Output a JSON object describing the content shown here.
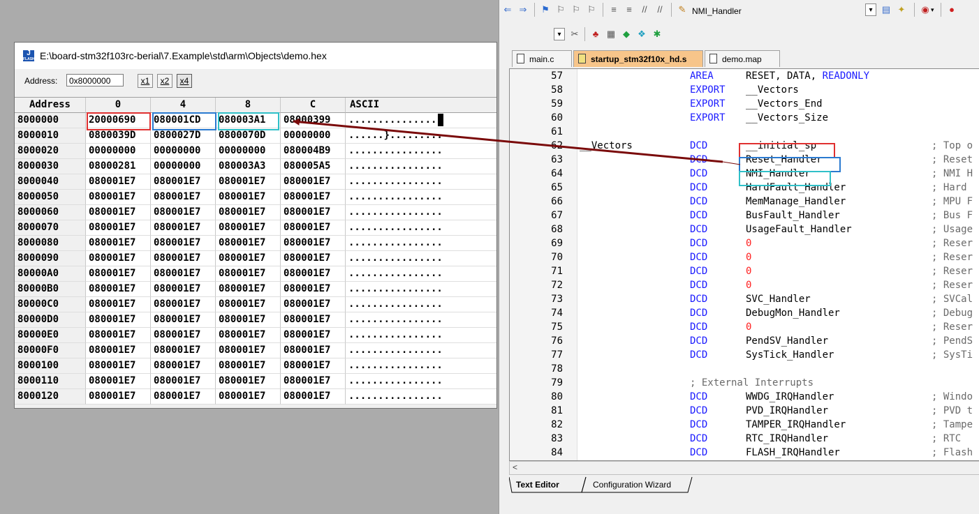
{
  "hex_window": {
    "title": "E:\\board-stm32f103rc-berial\\7.Example\\std\\arm\\Objects\\demo.hex",
    "icon_text": "J",
    "icon_subtext": "FLASH",
    "address_label": "Address:",
    "address_value": "0x8000000",
    "zoom_buttons": [
      "x1",
      "x2",
      "x4"
    ],
    "columns": [
      "Address",
      "0",
      "4",
      "8",
      "C",
      "ASCII"
    ],
    "rows": [
      [
        "8000000",
        "20000690",
        "080001CD",
        "080003A1",
        "08000399",
        "..............."
      ],
      [
        "8000010",
        "0800039D",
        "0800027D",
        "0800070D",
        "00000000",
        "......}........."
      ],
      [
        "8000020",
        "00000000",
        "00000000",
        "00000000",
        "080004B9",
        "................"
      ],
      [
        "8000030",
        "08000281",
        "00000000",
        "080003A3",
        "080005A5",
        "................"
      ],
      [
        "8000040",
        "080001E7",
        "080001E7",
        "080001E7",
        "080001E7",
        "................"
      ],
      [
        "8000050",
        "080001E7",
        "080001E7",
        "080001E7",
        "080001E7",
        "................"
      ],
      [
        "8000060",
        "080001E7",
        "080001E7",
        "080001E7",
        "080001E7",
        "................"
      ],
      [
        "8000070",
        "080001E7",
        "080001E7",
        "080001E7",
        "080001E7",
        "................"
      ],
      [
        "8000080",
        "080001E7",
        "080001E7",
        "080001E7",
        "080001E7",
        "................"
      ],
      [
        "8000090",
        "080001E7",
        "080001E7",
        "080001E7",
        "080001E7",
        "................"
      ],
      [
        "80000A0",
        "080001E7",
        "080001E7",
        "080001E7",
        "080001E7",
        "................"
      ],
      [
        "80000B0",
        "080001E7",
        "080001E7",
        "080001E7",
        "080001E7",
        "................"
      ],
      [
        "80000C0",
        "080001E7",
        "080001E7",
        "080001E7",
        "080001E7",
        "................"
      ],
      [
        "80000D0",
        "080001E7",
        "080001E7",
        "080001E7",
        "080001E7",
        "................"
      ],
      [
        "80000E0",
        "080001E7",
        "080001E7",
        "080001E7",
        "080001E7",
        "................"
      ],
      [
        "80000F0",
        "080001E7",
        "080001E7",
        "080001E7",
        "080001E7",
        "................"
      ],
      [
        "8000100",
        "080001E7",
        "080001E7",
        "080001E7",
        "080001E7",
        "................"
      ],
      [
        "8000110",
        "080001E7",
        "080001E7",
        "080001E7",
        "080001E7",
        "................"
      ],
      [
        "8000120",
        "080001E7",
        "080001E7",
        "080001E7",
        "080001E7",
        "................"
      ]
    ]
  },
  "editor": {
    "toolbar": {
      "function_combo": "NMI_Handler"
    },
    "tabs": [
      {
        "label": "main.c",
        "active": false
      },
      {
        "label": "startup_stm32f10x_hd.s",
        "active": true
      },
      {
        "label": "demo.map",
        "active": false
      }
    ],
    "lines": [
      {
        "n": "57",
        "label": "",
        "kw": "AREA",
        "op": "RESET, DATA, ",
        "op_kw": "READONLY",
        "cm": ""
      },
      {
        "n": "58",
        "label": "",
        "kw": "EXPORT",
        "op": "__Vectors",
        "op_kw": "",
        "cm": ""
      },
      {
        "n": "59",
        "label": "",
        "kw": "EXPORT",
        "op": "__Vectors_End",
        "op_kw": "",
        "cm": ""
      },
      {
        "n": "60",
        "label": "",
        "kw": "EXPORT",
        "op": "__Vectors_Size",
        "op_kw": "",
        "cm": ""
      },
      {
        "n": "61",
        "label": "",
        "kw": "",
        "op": "",
        "op_kw": "",
        "cm": ""
      },
      {
        "n": "62",
        "label": "__Vectors",
        "kw": "DCD",
        "op": "__initial_sp",
        "op_kw": "",
        "cm": "; Top o"
      },
      {
        "n": "63",
        "label": "",
        "kw": "DCD",
        "op": "Reset_Handler",
        "op_kw": "",
        "cm": "; Reset"
      },
      {
        "n": "64",
        "label": "",
        "kw": "DCD",
        "op": "NMI_Handler",
        "op_kw": "",
        "cm": "; NMI H"
      },
      {
        "n": "65",
        "label": "",
        "kw": "DCD",
        "op": "HardFault_Handler",
        "op_kw": "",
        "cm": "; Hard"
      },
      {
        "n": "66",
        "label": "",
        "kw": "DCD",
        "op": "MemManage_Handler",
        "op_kw": "",
        "cm": "; MPU F"
      },
      {
        "n": "67",
        "label": "",
        "kw": "DCD",
        "op": "BusFault_Handler",
        "op_kw": "",
        "cm": "; Bus F"
      },
      {
        "n": "68",
        "label": "",
        "kw": "DCD",
        "op": "UsageFault_Handler",
        "op_kw": "",
        "cm": "; Usage"
      },
      {
        "n": "69",
        "label": "",
        "kw": "DCD",
        "op": "0",
        "op_kw": "zero",
        "cm": "; Reser"
      },
      {
        "n": "70",
        "label": "",
        "kw": "DCD",
        "op": "0",
        "op_kw": "zero",
        "cm": "; Reser"
      },
      {
        "n": "71",
        "label": "",
        "kw": "DCD",
        "op": "0",
        "op_kw": "zero",
        "cm": "; Reser"
      },
      {
        "n": "72",
        "label": "",
        "kw": "DCD",
        "op": "0",
        "op_kw": "zero",
        "cm": "; Reser"
      },
      {
        "n": "73",
        "label": "",
        "kw": "DCD",
        "op": "SVC_Handler",
        "op_kw": "",
        "cm": "; SVCal"
      },
      {
        "n": "74",
        "label": "",
        "kw": "DCD",
        "op": "DebugMon_Handler",
        "op_kw": "",
        "cm": "; Debug"
      },
      {
        "n": "75",
        "label": "",
        "kw": "DCD",
        "op": "0",
        "op_kw": "zero",
        "cm": "; Reser"
      },
      {
        "n": "76",
        "label": "",
        "kw": "DCD",
        "op": "PendSV_Handler",
        "op_kw": "",
        "cm": "; PendS"
      },
      {
        "n": "77",
        "label": "",
        "kw": "DCD",
        "op": "SysTick_Handler",
        "op_kw": "",
        "cm": "; SysTi"
      },
      {
        "n": "78",
        "label": "",
        "kw": "",
        "op": "",
        "op_kw": "",
        "cm": ""
      },
      {
        "n": "79",
        "label": "",
        "kw": "; External Interrupts",
        "op": "",
        "op_kw": "comment",
        "cm": ""
      },
      {
        "n": "80",
        "label": "",
        "kw": "DCD",
        "op": "WWDG_IRQHandler",
        "op_kw": "",
        "cm": "; Windo"
      },
      {
        "n": "81",
        "label": "",
        "kw": "DCD",
        "op": "PVD_IRQHandler",
        "op_kw": "",
        "cm": "; PVD t"
      },
      {
        "n": "82",
        "label": "",
        "kw": "DCD",
        "op": "TAMPER_IRQHandler",
        "op_kw": "",
        "cm": "; Tampe"
      },
      {
        "n": "83",
        "label": "",
        "kw": "DCD",
        "op": "RTC_IRQHandler",
        "op_kw": "",
        "cm": "; RTC"
      },
      {
        "n": "84",
        "label": "",
        "kw": "DCD",
        "op": "FLASH_IRQHandler",
        "op_kw": "",
        "cm": "; Flash"
      }
    ],
    "bottom_tabs": [
      "Text Editor",
      "Configuration Wizard"
    ]
  },
  "colors": {
    "box_red": "#e03030",
    "box_blue": "#2a7ad0",
    "box_cyan": "#30c0c8",
    "arrow": "#7a0a0a",
    "keyword_blue": "#1a1aff",
    "zero_red": "#ff2020",
    "active_tab": "#f7c58a"
  }
}
